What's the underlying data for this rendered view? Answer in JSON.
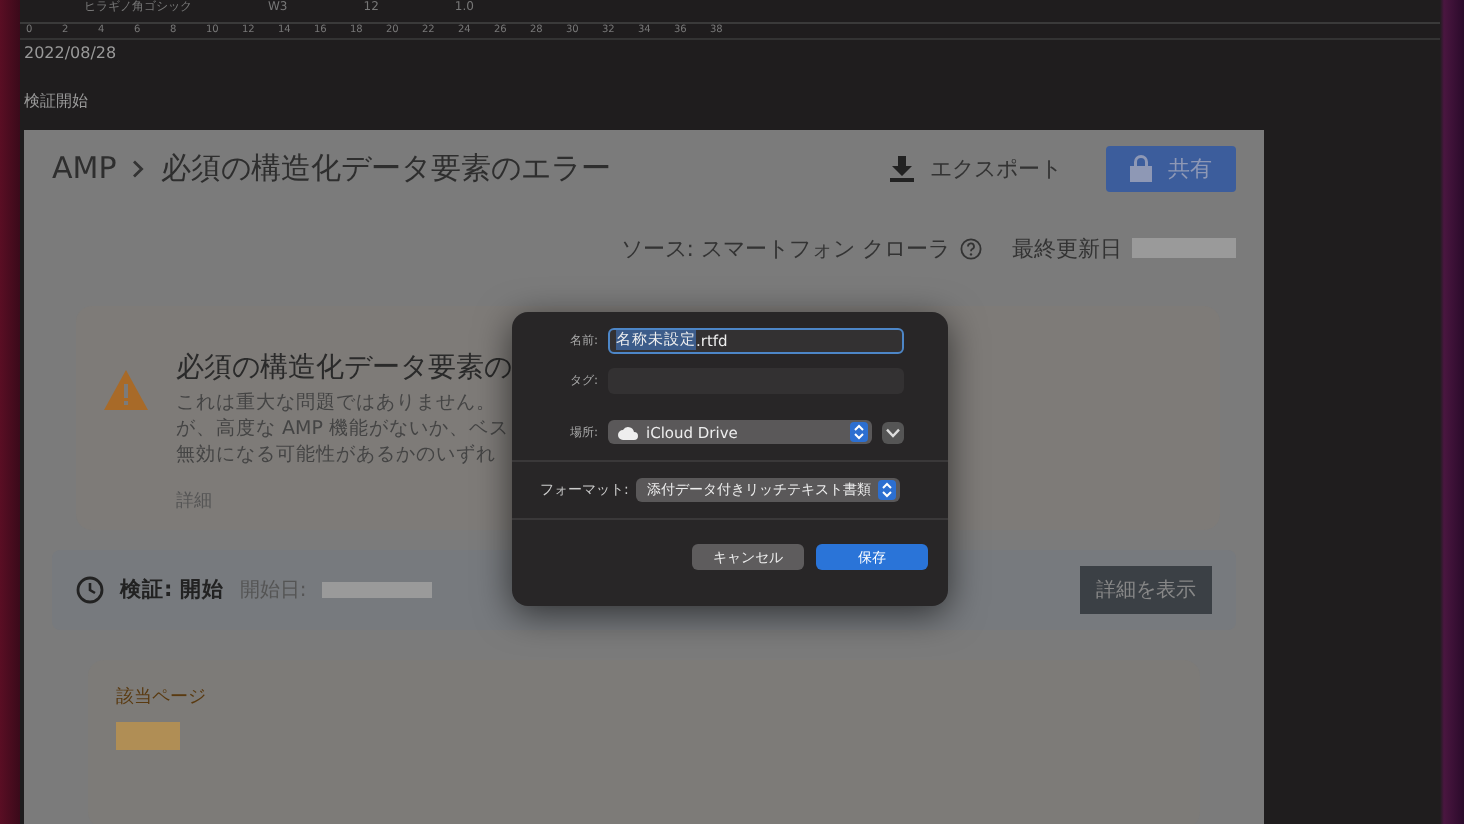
{
  "toolbar": {
    "font_name": "ヒラギノ角ゴシック",
    "font_weight": "W3",
    "font_size": "12",
    "line_spacing": "1.0"
  },
  "ruler": {
    "labels": [
      "0",
      "2",
      "4",
      "6",
      "8",
      "10",
      "12",
      "14",
      "16",
      "18",
      "20",
      "22",
      "24",
      "26",
      "28",
      "30",
      "32",
      "34",
      "36",
      "38"
    ]
  },
  "document": {
    "lines": [
      "2022/08/28",
      "検証開始"
    ]
  },
  "report": {
    "breadcrumb": [
      {
        "label": "AMP"
      },
      {
        "label": "必須の構造化データ要素のエラー"
      }
    ],
    "export_label": "エクスポート",
    "share_label": "共有",
    "source_text": "ソース: スマートフォン クローラ",
    "updated_label": "最終更新日",
    "issue": {
      "title": "必須の構造化データ要素の",
      "lines": [
        "これは重大な問題ではありません。",
        "が、高度な AMP 機能がないか、ベス",
        "無効になる可能性があるかのいずれ"
      ],
      "details_link": "詳細"
    },
    "validation": {
      "label": "検証: 開始",
      "start_label": "開始日:",
      "button": "詳細を表示"
    },
    "pages": {
      "title": "該当ページ"
    }
  },
  "dialog": {
    "name_label": "名前:",
    "name_selected": "名称未設定",
    "name_ext": ".rtfd",
    "tags_label": "タグ:",
    "where_label": "場所:",
    "where_value": "iCloud Drive",
    "format_label": "フォーマット:",
    "format_value": "添付データ付きリッチテキスト書類",
    "cancel": "キャンセル",
    "save": "保存"
  }
}
